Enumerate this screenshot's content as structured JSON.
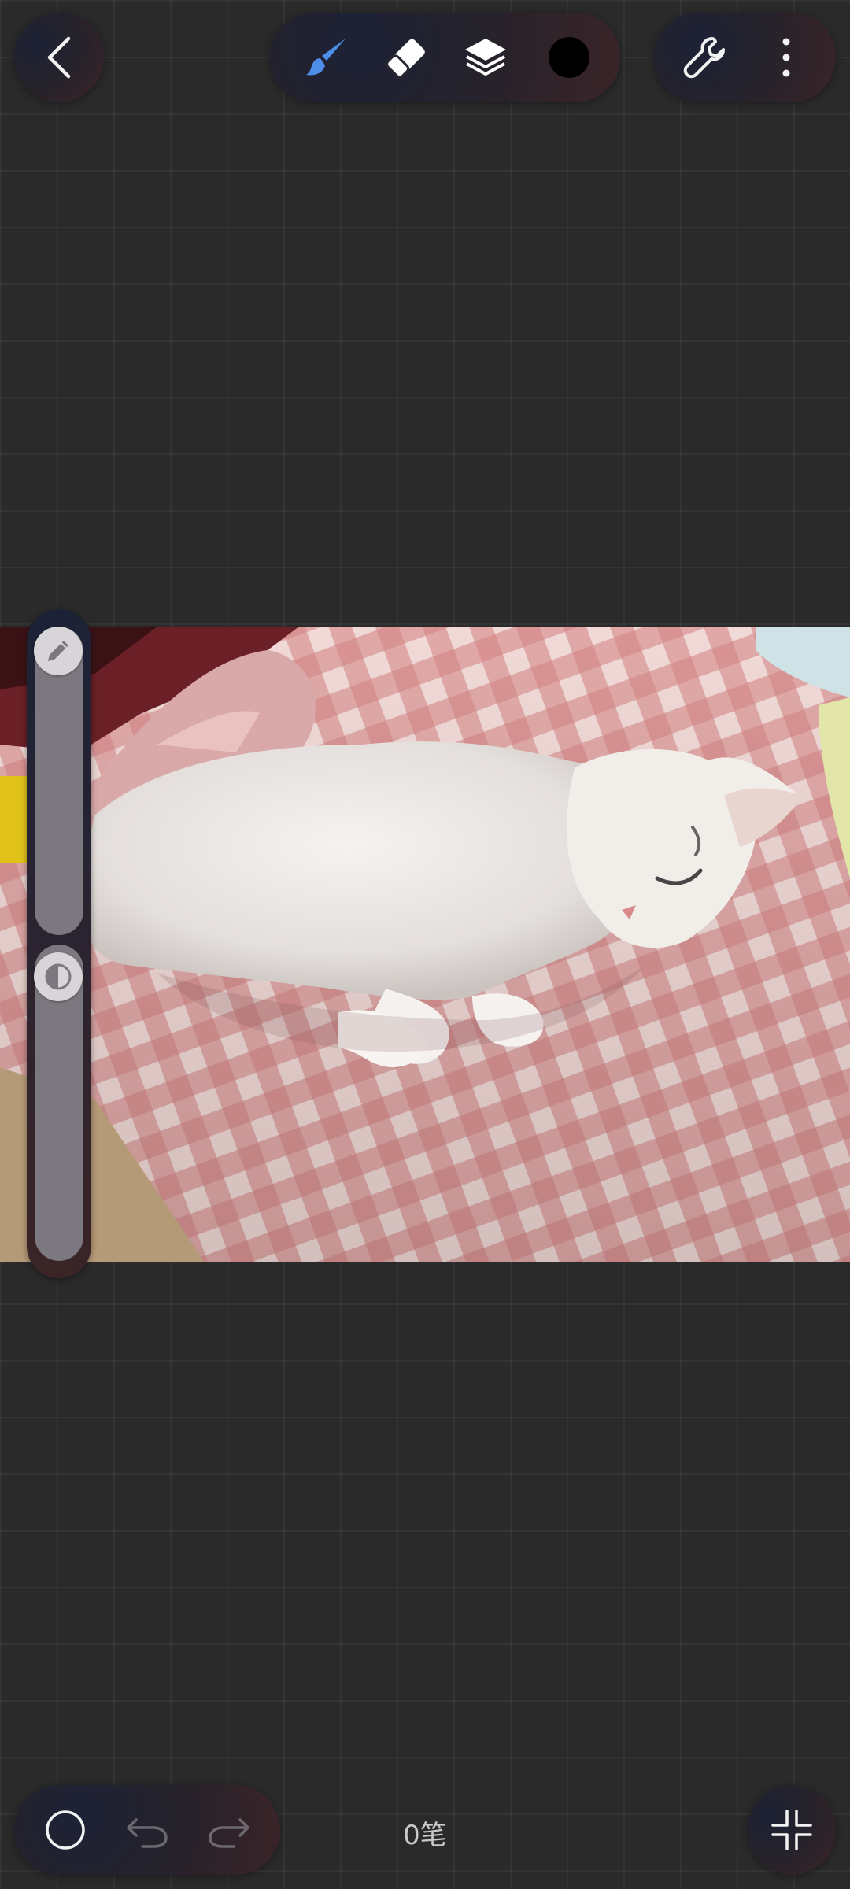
{
  "toolbar": {
    "back": {
      "icon": "chevron-left-icon"
    },
    "tools": [
      {
        "name": "brush",
        "icon": "brush-icon",
        "active": true,
        "color": "#4d8ee8"
      },
      {
        "name": "eraser",
        "icon": "eraser-icon",
        "active": false
      },
      {
        "name": "layers",
        "icon": "layers-icon",
        "active": false
      },
      {
        "name": "color",
        "icon": "color-swatch-icon",
        "color": "#000000"
      }
    ],
    "settings": {
      "icon": "wrench-icon"
    },
    "more": {
      "icon": "more-vertical-icon"
    }
  },
  "canvas": {
    "photo": {
      "subject": "cat-photo"
    }
  },
  "slider_panel": {
    "brush_size": {
      "icon": "pencil-icon",
      "level": 1.0
    },
    "brush_opacity": {
      "icon": "opacity-icon",
      "level": 1.0
    }
  },
  "bottom_bar": {
    "brush_preview": {
      "icon": "circle-outline-icon"
    },
    "undo": {
      "icon": "undo-icon",
      "enabled": false
    },
    "redo": {
      "icon": "redo-icon",
      "enabled": false
    },
    "stroke_count": "0笔",
    "exit_fullscreen": {
      "icon": "collapse-icon"
    }
  },
  "colors": {
    "background": "#2a2a2a",
    "accent": "#4d8ee8"
  }
}
